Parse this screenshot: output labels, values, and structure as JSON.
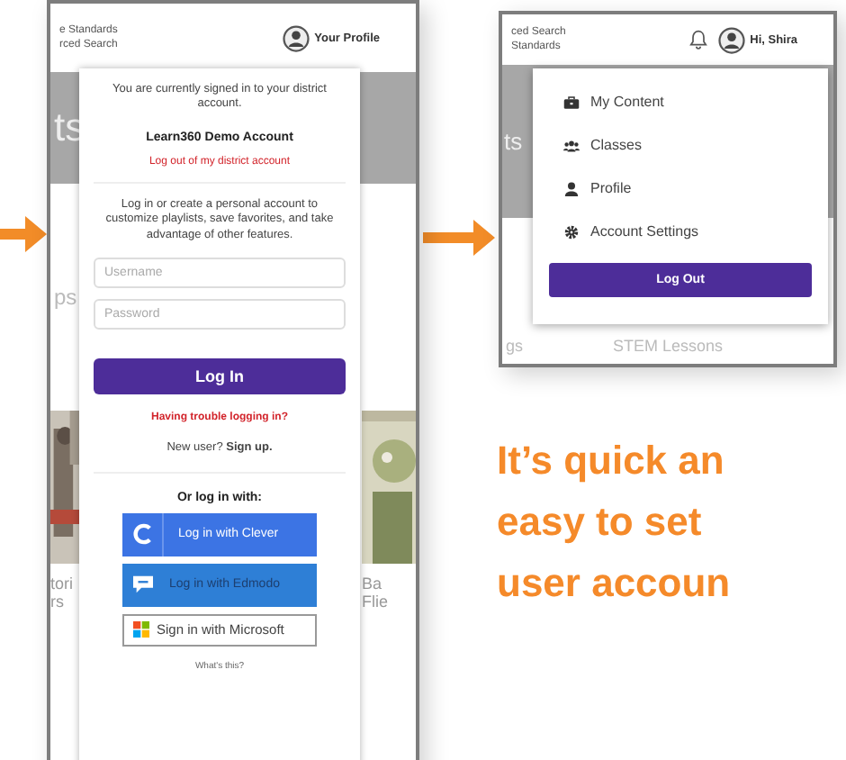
{
  "profile_login_screen": {
    "header_links": [
      "e Standards",
      "rced Search"
    ],
    "profile_label": "Your Profile",
    "hero_text": "ts",
    "section_text": "ps",
    "captions_left": [
      "tori",
      "rs"
    ],
    "captions_right": [
      "Ba",
      "Flie"
    ],
    "dropdown": {
      "signed_in_message": "You are currently signed in to your district account.",
      "account_name": "Learn360 Demo Account",
      "district_logout_link": "Log out of my district account",
      "intro": "Log in or create a personal account to customize playlists, save favorites, and take advantage of other features.",
      "username_placeholder": "Username",
      "password_placeholder": "Password",
      "login_button": "Log In",
      "trouble_link": "Having trouble logging in?",
      "new_user": "New user? **Sign up.**",
      "or_login_with": "Or log in with:",
      "providers": [
        {
          "kind": "clever",
          "label": "Log in with Clever"
        },
        {
          "kind": "edmodo",
          "label": "Log in with Edmodo"
        },
        {
          "kind": "microsoft",
          "label": "Sign in with Microsoft"
        }
      ],
      "whats_this": "What's this?"
    }
  },
  "account_menu_screen": {
    "header_links": [
      "ced Search",
      "Standards"
    ],
    "greeting": "Hi, Shira",
    "hero_text": "ts",
    "below_texts": [
      "gs",
      "STEM Lessons"
    ],
    "menu_items": [
      {
        "kind": "content",
        "label": "My Content"
      },
      {
        "kind": "classes",
        "label": "Classes"
      },
      {
        "kind": "profile",
        "label": "Profile"
      },
      {
        "kind": "settings",
        "label": "Account Settings"
      }
    ],
    "logout_button": "Log Out"
  },
  "headline_lines": [
    "It’s quick an",
    "easy to set",
    "user accoun"
  ]
}
